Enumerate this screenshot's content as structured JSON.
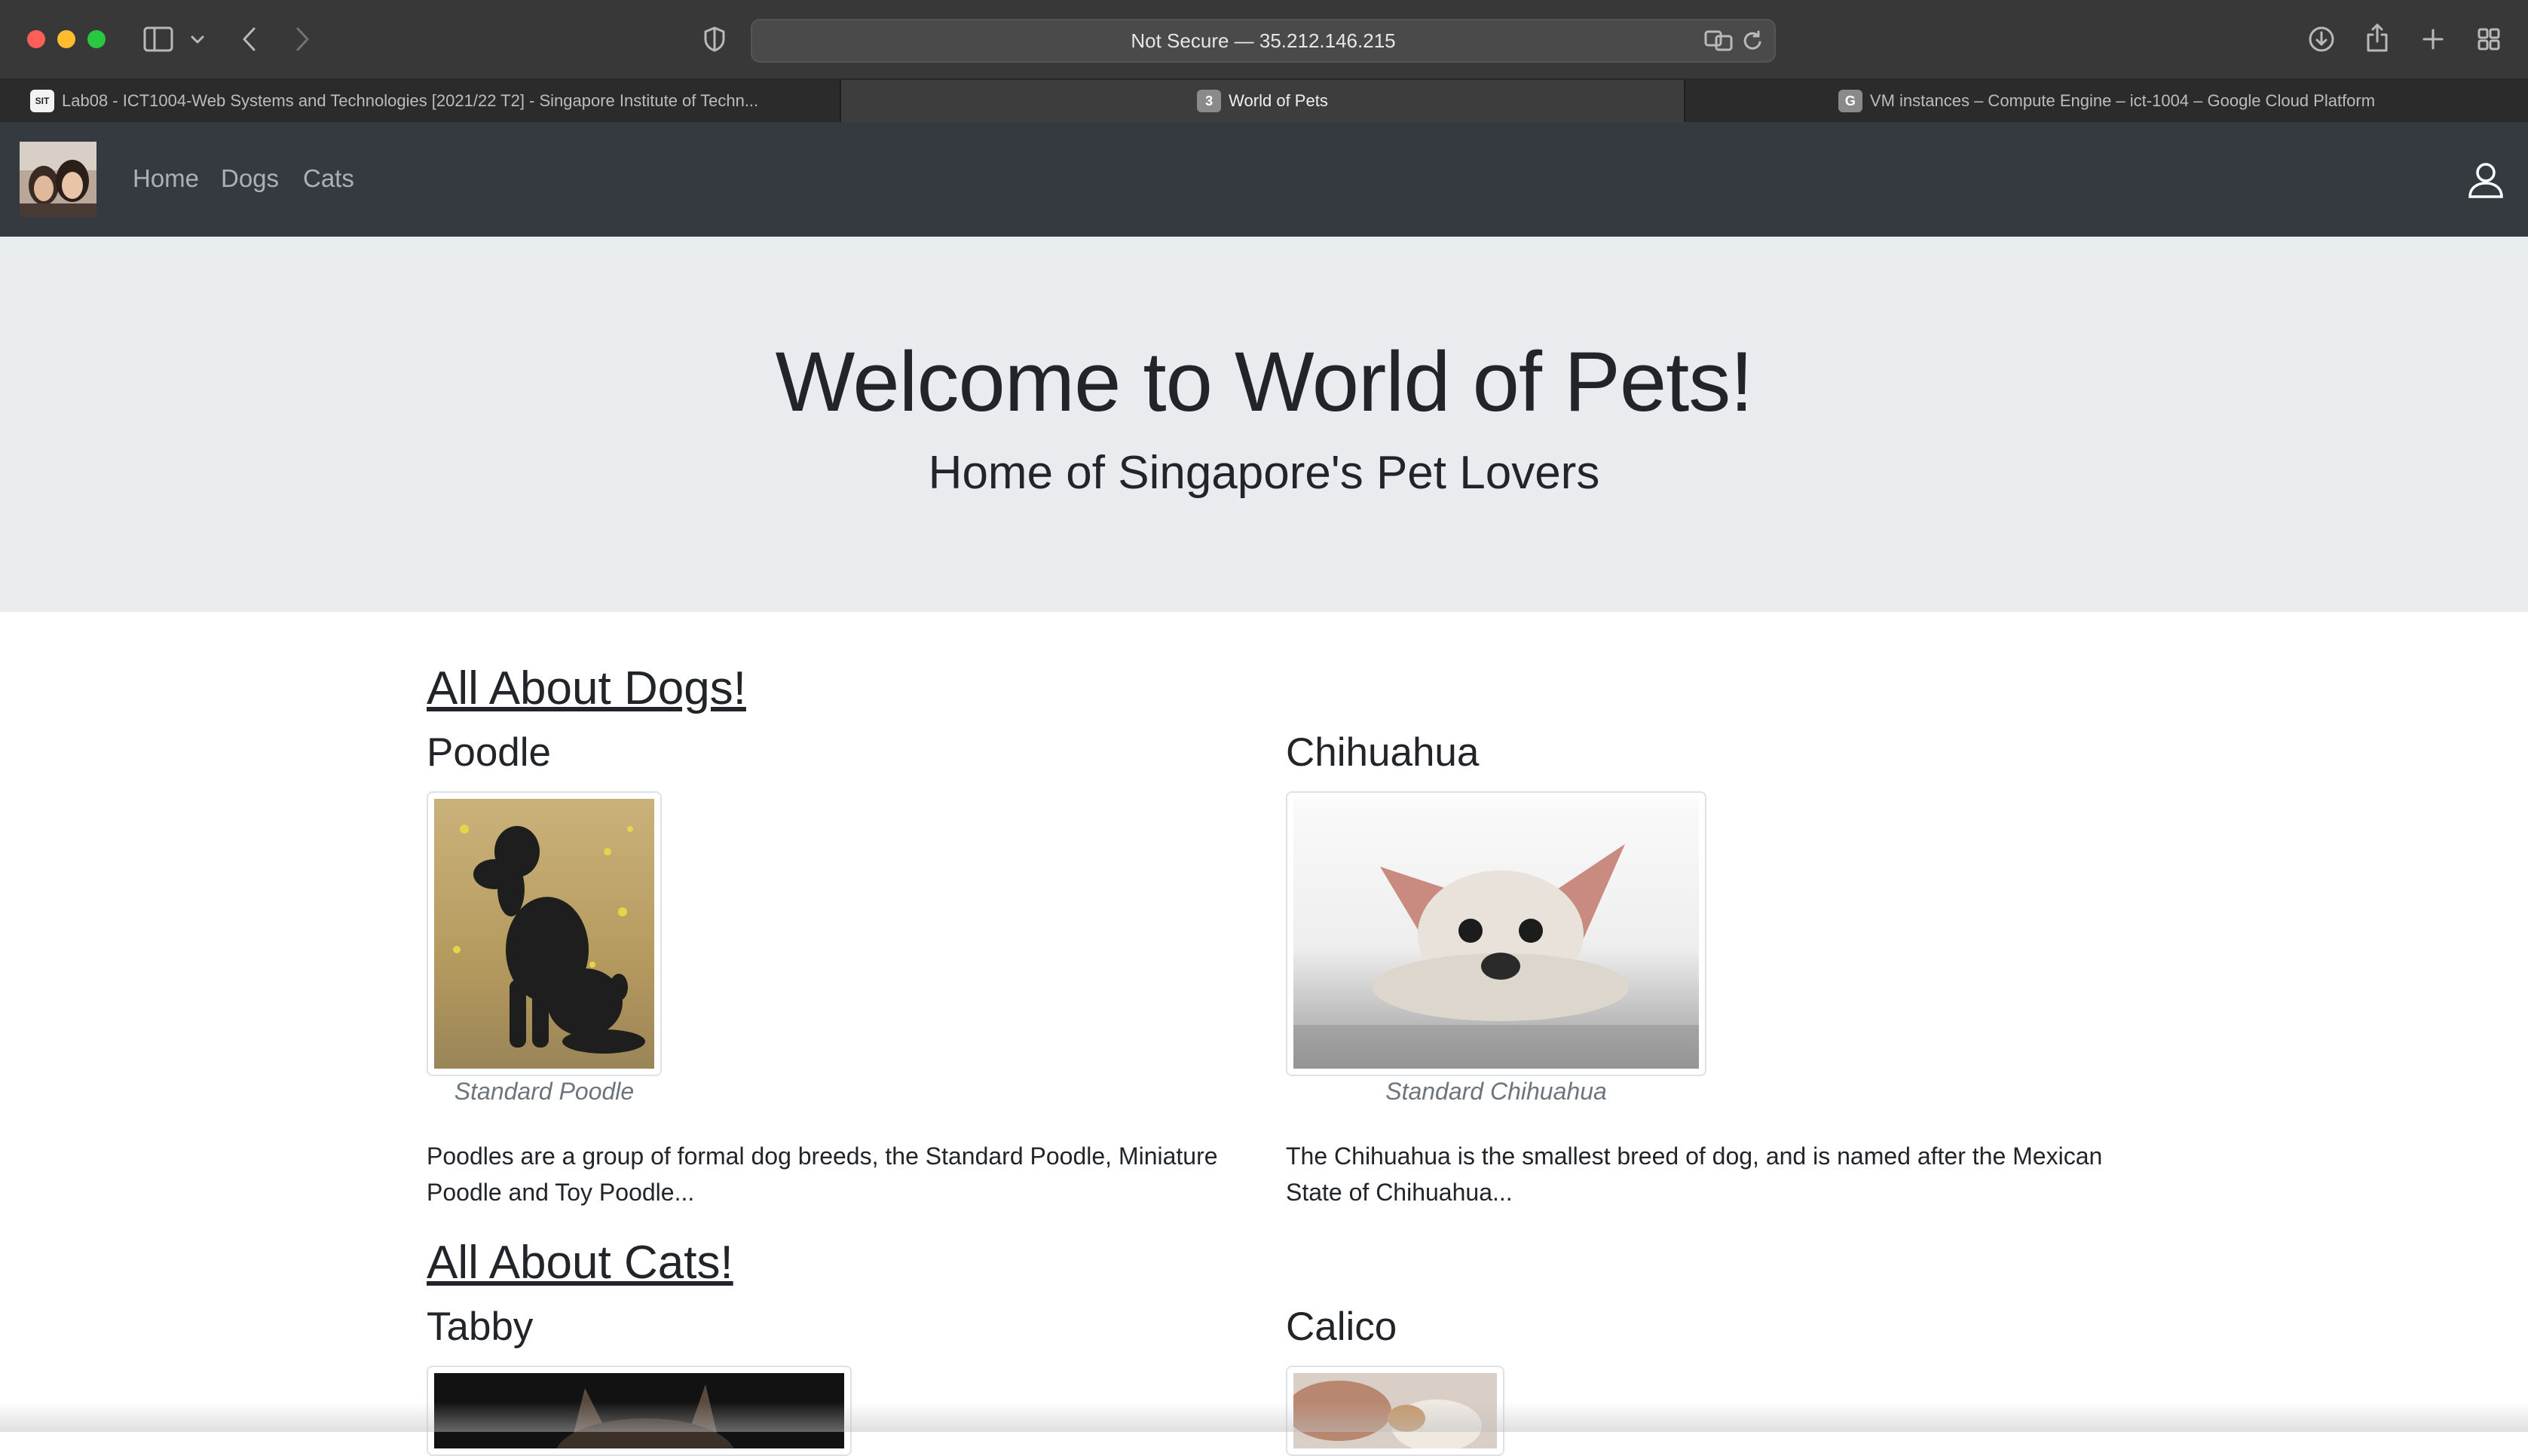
{
  "browser": {
    "url": "Not Secure — 35.212.146.215",
    "tabs": [
      {
        "label": "Lab08 - ICT1004-Web Systems and Technologies [2021/22 T2] - Singapore Institute of Techn...",
        "favicon": "SIT",
        "active": false
      },
      {
        "label": "World of Pets",
        "favicon": "3",
        "active": true
      },
      {
        "label": "VM instances – Compute Engine – ict-1004 – Google Cloud Platform",
        "favicon": "G",
        "active": false
      }
    ]
  },
  "nav": {
    "links": [
      "Home",
      "Dogs",
      "Cats"
    ],
    "user_icon": "user-icon"
  },
  "jumbotron": {
    "title": "Welcome to World of Pets!",
    "subtitle": "Home of Singapore's Pet Lovers"
  },
  "dogs": {
    "heading": "All About Dogs!",
    "items": [
      {
        "name": "Poodle",
        "caption": "Standard Poodle",
        "description": "Poodles are a group of formal dog breeds, the Standard Poodle, Miniature Poodle and Toy Poodle..."
      },
      {
        "name": "Chihuahua",
        "caption": "Standard Chihuahua",
        "description": "The Chihuahua is the smallest breed of dog, and is named after the Mexican State of Chihuahua..."
      }
    ]
  },
  "cats": {
    "heading": "All About Cats!",
    "items": [
      {
        "name": "Tabby"
      },
      {
        "name": "Calico"
      }
    ]
  }
}
